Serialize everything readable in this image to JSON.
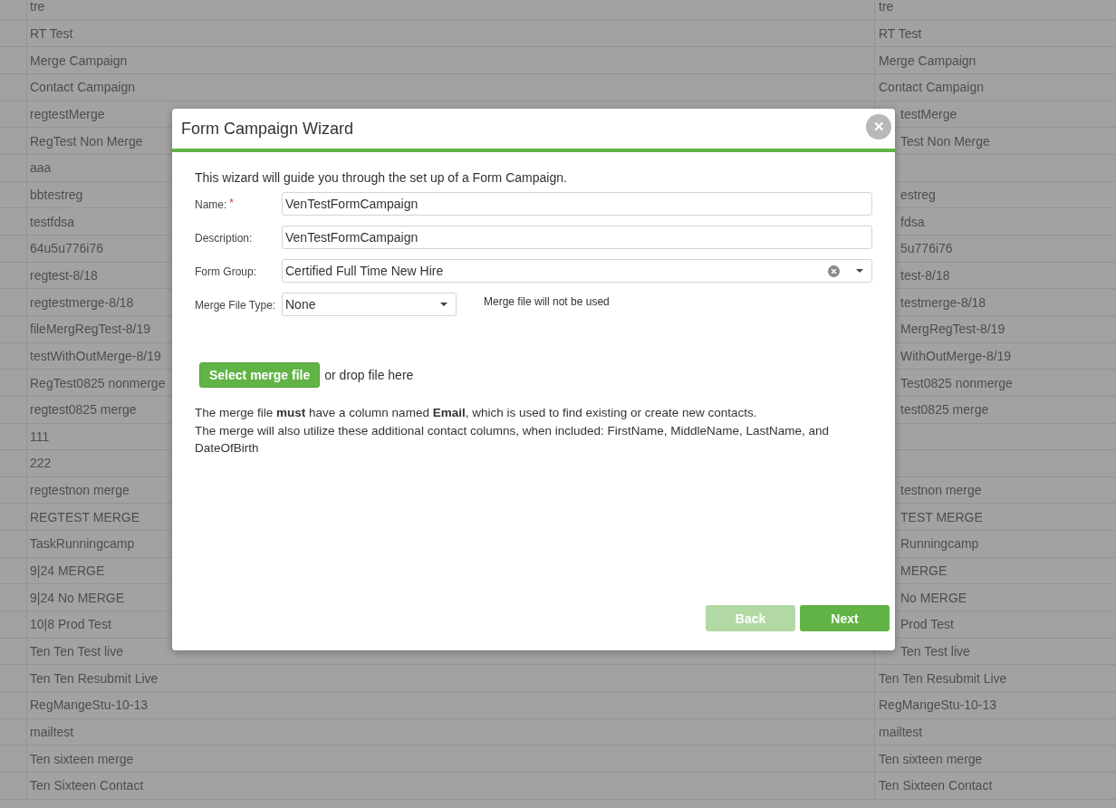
{
  "table": {
    "rows": [
      {
        "name": "tre",
        "name_2": "tre",
        "behind_dialog": false
      },
      {
        "name": "RT Test",
        "name_2": "RT Test",
        "behind_dialog": false
      },
      {
        "name": "Merge Campaign",
        "name_2": "Merge Campaign",
        "behind_dialog": false
      },
      {
        "name": "Contact Campaign",
        "name_2": "Contact Campaign",
        "behind_dialog": false
      },
      {
        "name": "regtestMerge",
        "name_2": "testMerge",
        "behind_dialog": true
      },
      {
        "name": "RegTest Non Merge",
        "name_2": "Test Non Merge",
        "behind_dialog": true
      },
      {
        "name": "aaa"
      },
      {
        "name": "bbtestreg",
        "name_2": "estreg",
        "behind_dialog": true
      },
      {
        "name": "testfdsa",
        "name_2": "fdsa",
        "behind_dialog": true
      },
      {
        "name": "64u5u776i76",
        "name_2": "5u776i76",
        "behind_dialog": true
      },
      {
        "name": "regtest-8/18",
        "name_2": "test-8/18",
        "behind_dialog": true
      },
      {
        "name": "regtestmerge-8/18",
        "name_2": "testmerge-8/18",
        "behind_dialog": true
      },
      {
        "name": "fileMergRegTest-8/19",
        "name_2": "MergRegTest-8/19",
        "behind_dialog": true
      },
      {
        "name": "testWithOutMerge-8/19",
        "name_2": "WithOutMerge-8/19",
        "behind_dialog": true
      },
      {
        "name": "RegTest0825 nonmerge",
        "name_2": "Test0825 nonmerge",
        "behind_dialog": true
      },
      {
        "name": "regtest0825 merge",
        "name_2": "test0825 merge",
        "behind_dialog": true
      },
      {
        "name": "111"
      },
      {
        "name": "222"
      },
      {
        "name": "regtestnon merge",
        "name_2": "testnon merge",
        "behind_dialog": true
      },
      {
        "name": "REGTEST MERGE",
        "name_2": "TEST MERGE",
        "behind_dialog": true
      },
      {
        "name": "TaskRunningcamp",
        "name_2": "Runningcamp",
        "behind_dialog": true
      },
      {
        "name": "9|24 MERGE",
        "name_2": "MERGE",
        "behind_dialog": true
      },
      {
        "name": "9|24 No MERGE",
        "name_2": "No MERGE",
        "behind_dialog": true
      },
      {
        "name": "10|8 Prod Test",
        "name_2": "Prod Test",
        "behind_dialog": true
      },
      {
        "name": "Ten Ten Test live",
        "name_2": "Ten Test live",
        "behind_dialog": true
      },
      {
        "name": "Ten Ten Resubmit Live",
        "name_2": "Ten Ten Resubmit Live",
        "behind_dialog": false
      },
      {
        "name": "RegMangeStu-10-13",
        "name_2": "RegMangeStu-10-13",
        "behind_dialog": false
      },
      {
        "name": "mailtest",
        "name_2": "mailtest",
        "behind_dialog": false
      },
      {
        "name": "Ten sixteen merge",
        "name_2": "Ten sixteen merge",
        "behind_dialog": false
      },
      {
        "name": "Ten Sixteen Contact",
        "name_2": "Ten Sixteen Contact",
        "behind_dialog": false
      }
    ]
  },
  "dialog": {
    "title": "Form Campaign Wizard",
    "close": "✕",
    "intro": "This wizard will guide you through the set up of a Form Campaign.",
    "fields": [
      {
        "label": "Name:",
        "required_mark": "*",
        "kind": "text",
        "value": "VenTestFormCampaign"
      },
      {
        "label": "Description:",
        "kind": "text",
        "value": "VenTestFormCampaign"
      },
      {
        "label": "Form Group:",
        "kind": "combo",
        "value": "Certified Full Time New Hire"
      },
      {
        "label": "Merge File Type:",
        "kind": "select",
        "value": "None",
        "note": "Merge file will not be used"
      }
    ],
    "upload": {
      "button": "Select merge file",
      "hint": "or drop file here"
    },
    "notes": [
      "The merge file **must** have a column named **Email**, which is used to find existing or create new contacts.",
      "The merge will also utilize these additional contact columns, when included: FirstName, MiddleName, LastName, and DateOfBirth"
    ],
    "buttons": [
      {
        "label": "Back",
        "disabled": true
      },
      {
        "label": "Next",
        "disabled": false
      }
    ]
  }
}
